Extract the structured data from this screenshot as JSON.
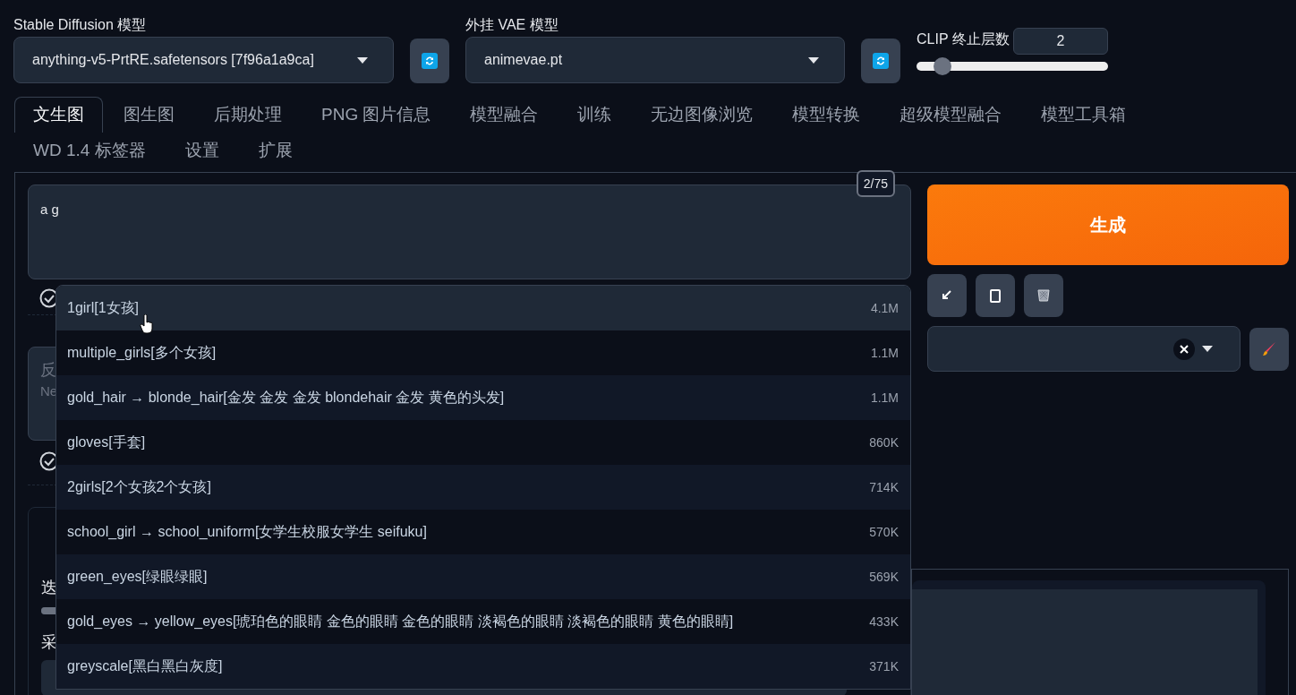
{
  "model_bar": {
    "sd_model": {
      "label": "Stable Diffusion 模型",
      "value": "anything-v5-PrtRE.safetensors [7f96a1a9ca]"
    },
    "vae": {
      "label": "外挂 VAE 模型",
      "value": "animevae.pt"
    },
    "clip_skip": {
      "label": "CLIP 终止层数",
      "value": "2",
      "level": 0.1
    }
  },
  "tabs": [
    {
      "label": "文生图",
      "selected": true
    },
    {
      "label": "图生图",
      "selected": false
    },
    {
      "label": "后期处理",
      "selected": false
    },
    {
      "label": "PNG 图片信息",
      "selected": false
    },
    {
      "label": "模型融合",
      "selected": false
    },
    {
      "label": "训练",
      "selected": false
    },
    {
      "label": "无边图像浏览",
      "selected": false
    },
    {
      "label": "模型转换",
      "selected": false
    },
    {
      "label": "超级模型融合",
      "selected": false
    },
    {
      "label": "模型工具箱",
      "selected": false
    },
    {
      "label": "WD 1.4 标签器",
      "selected": false
    },
    {
      "label": "设置",
      "selected": false
    },
    {
      "label": "扩展",
      "selected": false
    }
  ],
  "prompt": {
    "value": "a g",
    "token_count": "2/75"
  },
  "negative_prompt": {
    "label_fragment": "反",
    "placeholder_fragment": "Ne"
  },
  "settings_panel": {
    "fragments": [
      "迭",
      "采"
    ],
    "level": 0.05
  },
  "autocomplete": {
    "items": [
      {
        "tag": "1girl[1女孩]",
        "count": "4.1M",
        "selected": true
      },
      {
        "tag": "multiple_girls[多个女孩]",
        "count": "1.1M",
        "selected": false
      },
      {
        "tag": "gold_hair → blonde_hair[金发 金发 金发 blondehair 金发 黄色的头发]",
        "count": "1.1M",
        "selected": false
      },
      {
        "tag": "gloves[手套]",
        "count": "860K",
        "selected": false
      },
      {
        "tag": "2girls[2个女孩2个女孩]",
        "count": "714K",
        "selected": false
      },
      {
        "tag": "school_girl → school_uniform[女学生校服女学生 seifuku]",
        "count": "570K",
        "selected": false
      },
      {
        "tag": "green_eyes[绿眼绿眼]",
        "count": "569K",
        "selected": false
      },
      {
        "tag": "gold_eyes → yellow_eyes[琥珀色的眼睛 金色的眼睛 金色的眼睛 淡褐色的眼睛 淡褐色的眼睛 黄色的眼睛]",
        "count": "433K",
        "selected": false
      },
      {
        "tag": "greyscale[黑白黑白灰度]",
        "count": "371K",
        "selected": false
      }
    ]
  },
  "generate_button": "生成"
}
